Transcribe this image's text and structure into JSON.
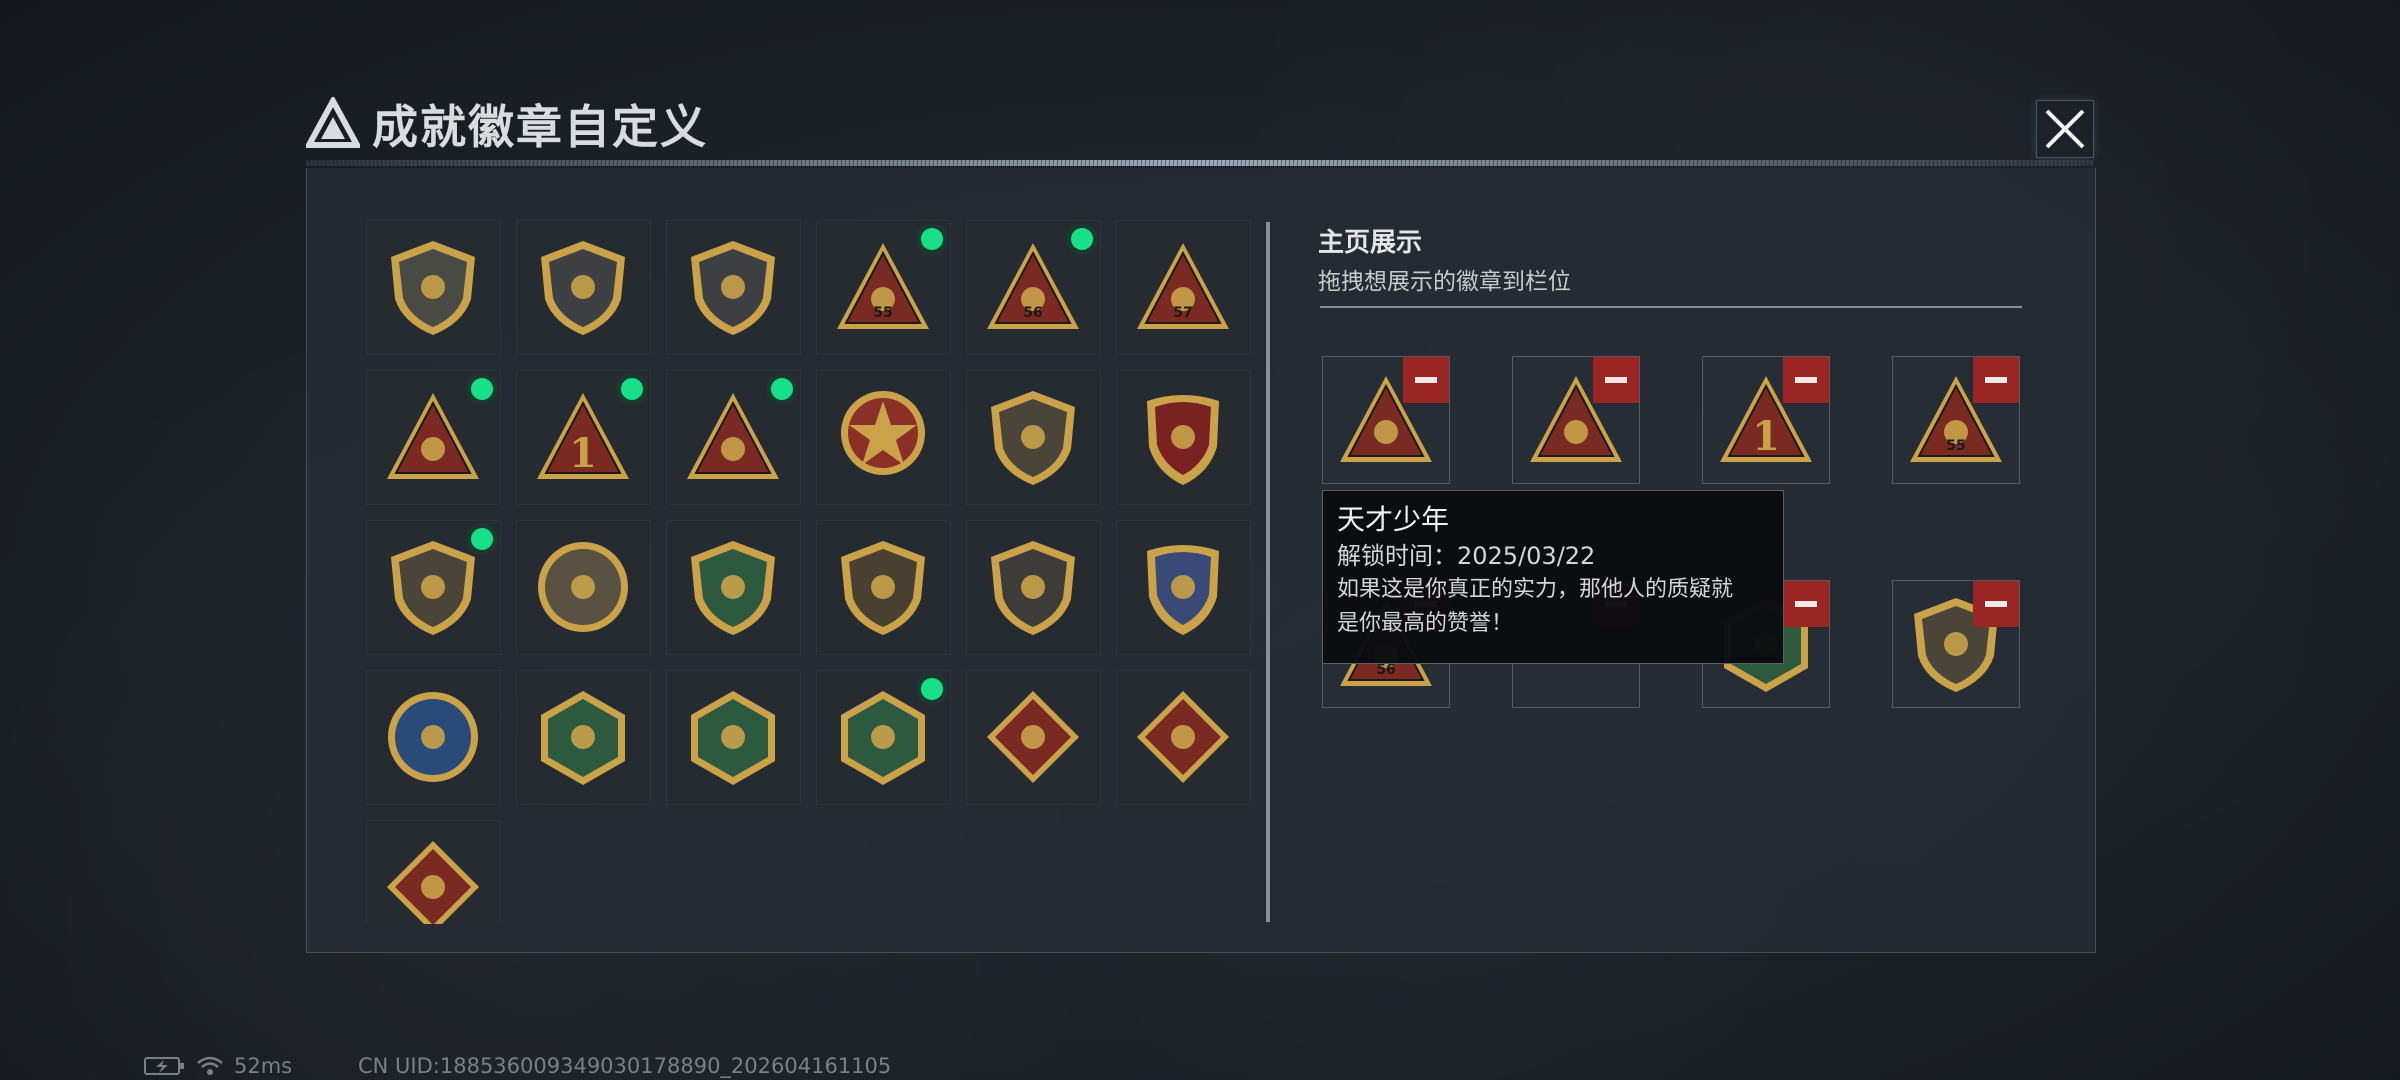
{
  "window": {
    "title": "成就徽章自定义",
    "tiny_caption": "",
    "close_icon": "close-icon"
  },
  "badges": [
    {
      "name": "logo-shield-badge",
      "shape": "shield",
      "color": "#4a4a44",
      "symbol": "logo",
      "unlocked": false
    },
    {
      "name": "helicopter-badge",
      "shape": "shield",
      "color": "#3e4044",
      "symbol": "heli",
      "unlocked": false
    },
    {
      "name": "dagger-badge",
      "shape": "shield",
      "color": "#3e3f43",
      "symbol": "dagger",
      "unlocked": false
    },
    {
      "name": "backpack-55-badge",
      "shape": "triangle",
      "color": "#7a2a22",
      "symbol": "bag",
      "label": "55",
      "unlocked": true
    },
    {
      "name": "cargo-56-badge",
      "shape": "triangle",
      "color": "#7a2a22",
      "symbol": "cargo",
      "label": "56",
      "unlocked": true
    },
    {
      "name": "case-57-badge",
      "shape": "triangle",
      "color": "#7a2a22",
      "symbol": "case",
      "label": "57",
      "unlocked": false
    },
    {
      "name": "nest-eggs-badge",
      "shape": "triangle",
      "color": "#7a2a22",
      "symbol": "nest",
      "unlocked": true
    },
    {
      "name": "number-one-badge",
      "shape": "triangle",
      "color": "#7a2a22",
      "symbol": "one",
      "unlocked": true
    },
    {
      "name": "usb-drive-badge",
      "shape": "triangle",
      "color": "#7a2a22",
      "symbol": "usb",
      "unlocked": true
    },
    {
      "name": "star-medal-badge",
      "shape": "roundel",
      "color": "#8a3026",
      "symbol": "star",
      "unlocked": false
    },
    {
      "name": "wing-crest-badge",
      "shape": "shield",
      "color": "#4a4538",
      "symbol": "crest",
      "unlocked": false
    },
    {
      "name": "elite-crest-badge",
      "shape": "crest",
      "color": "#7a2222",
      "symbol": "crest",
      "unlocked": false
    },
    {
      "name": "d20-shield-badge",
      "shape": "shield",
      "color": "#4a4538",
      "symbol": "d20",
      "unlocked": true
    },
    {
      "name": "skull-medal-badge",
      "shape": "circle",
      "color": "#5a5240",
      "symbol": "skull",
      "unlocked": false
    },
    {
      "name": "sniper-green-badge",
      "shape": "shield",
      "color": "#2d5a3e",
      "symbol": "scope",
      "unlocked": false
    },
    {
      "name": "rifle-bronze-badge",
      "shape": "shield",
      "color": "#4a4032",
      "symbol": "rifle",
      "unlocked": false
    },
    {
      "name": "rifle-dark-badge",
      "shape": "shield",
      "color": "#3e3c38",
      "symbol": "rifle",
      "unlocked": false
    },
    {
      "name": "missile-gold-badge",
      "shape": "crest",
      "color": "#3a4a78",
      "symbol": "missile",
      "unlocked": false
    },
    {
      "name": "eagle-blue-badge",
      "shape": "circle",
      "color": "#2a4a7a",
      "symbol": "eagle",
      "unlocked": false
    },
    {
      "name": "hornet-green-badge",
      "shape": "hexagon",
      "color": "#2d5a3e",
      "symbol": "hornet",
      "unlocked": false
    },
    {
      "name": "arm-green-badge",
      "shape": "hexagon",
      "color": "#2d5a3e",
      "symbol": "arm",
      "unlocked": false
    },
    {
      "name": "soldier-green-badge",
      "shape": "hexagon",
      "color": "#2d5a3e",
      "symbol": "soldier",
      "unlocked": true
    },
    {
      "name": "dragon-red-badge",
      "shape": "diamond",
      "color": "#7a2a22",
      "symbol": "dragon",
      "unlocked": false
    },
    {
      "name": "runner-red-badge",
      "shape": "diamond",
      "color": "#7a2a22",
      "symbol": "runner",
      "unlocked": false
    },
    {
      "name": "armor-red-badge",
      "shape": "diamond",
      "color": "#7a2a22",
      "symbol": "armor",
      "unlocked": false
    }
  ],
  "showcase": {
    "title": "主页展示",
    "subtitle": "拖拽想展示的徽章到栏位",
    "slots": [
      {
        "badge": "usb-drive-badge",
        "filled": true
      },
      {
        "badge": "nest-eggs-badge",
        "filled": true
      },
      {
        "badge": "number-one-badge",
        "filled": true
      },
      {
        "badge": "backpack-55-badge",
        "filled": true
      },
      {
        "badge": "cargo-56-badge",
        "filled": true
      },
      {
        "badge": "",
        "filled": false
      },
      {
        "badge": "soldier-green-badge",
        "filled": true
      },
      {
        "badge": "d20-shield-badge",
        "filled": true
      }
    ],
    "remove_icon": "minus-icon"
  },
  "tooltip": {
    "title": "天才少年",
    "unlock_time": "解锁时间：2025/03/22",
    "desc_line1": "如果这是你真正的实力，那他人的质疑就",
    "desc_line2": "是你最高的赞誉！"
  },
  "status_bar": {
    "battery_icon": "battery-charging-icon",
    "wifi_icon": "wifi-icon",
    "ping": "52ms",
    "uid": "CN UID:188536009349030178890_202604161105"
  },
  "colors": {
    "unlock_dot": "#18e08a",
    "remove_button": "#9b2424",
    "gold": "#c9a24a"
  }
}
